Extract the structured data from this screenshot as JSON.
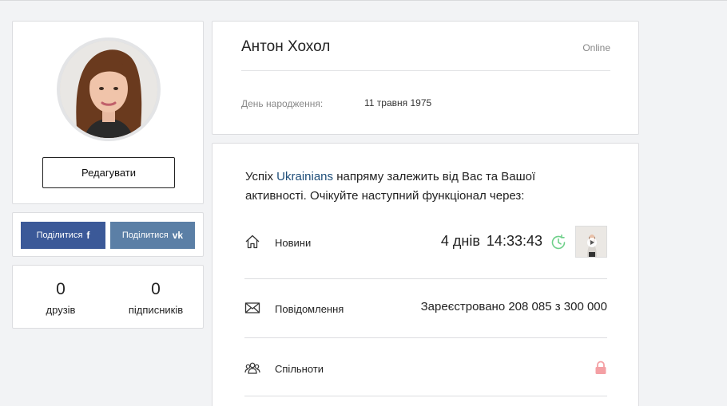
{
  "profile": {
    "edit_button": "Редагувати"
  },
  "share": {
    "facebook_label": "Поділитися",
    "facebook_icon": "f",
    "vk_label": "Поділитися",
    "vk_icon": "vk",
    "facebook_color": "#3b5998",
    "vk_color": "#5b7fa6"
  },
  "stats": {
    "friends_count": "0",
    "friends_label": "друзів",
    "followers_count": "0",
    "followers_label": "підписників"
  },
  "user": {
    "name": "Антон Хохол",
    "status": "Online",
    "birthday_label": "День народження:",
    "birthday_value": "11 травня 1975"
  },
  "intro": {
    "text_before": "Успіх ",
    "link": "Ukrainians",
    "text_after": " напряму залежить від Вас та Вашої активності. Очікуйте наступний функціонал через:"
  },
  "features": {
    "news": {
      "label": "Новини",
      "icon": "home-icon",
      "days": "4 днів",
      "time": "14:33:43",
      "clock_icon": "clock-refresh-icon",
      "clock_color": "#6fd08a"
    },
    "messages": {
      "label": "Повідомлення",
      "icon": "envelope-icon",
      "registered": "Зареєстровано 208 085 з 300 000"
    },
    "communities": {
      "label": "Спільноти",
      "icon": "users-icon",
      "lock_icon": "lock-icon",
      "lock_color": "#f4a0a4"
    }
  }
}
